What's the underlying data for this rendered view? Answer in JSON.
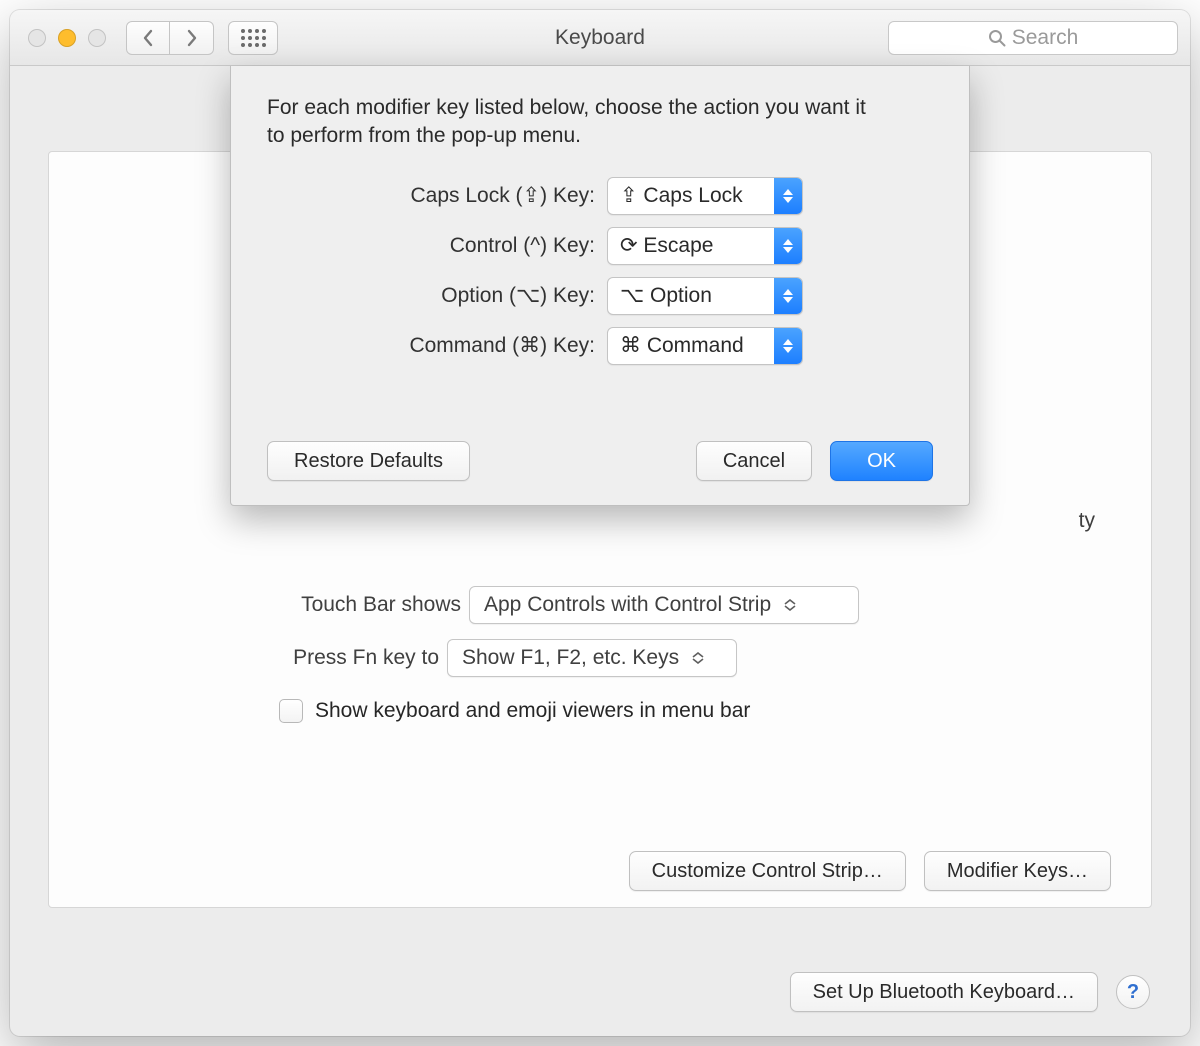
{
  "window": {
    "title": "Keyboard",
    "search_placeholder": "Search"
  },
  "sheet": {
    "description": "For each modifier key listed below, choose the action you want it to perform from the pop-up menu.",
    "rows": [
      {
        "label": "Caps Lock (⇪) Key:",
        "value": "⇪ Caps Lock"
      },
      {
        "label": "Control (^) Key:",
        "value": "⟳ Escape"
      },
      {
        "label": "Option (⌥) Key:",
        "value": "⌥ Option"
      },
      {
        "label": "Command (⌘) Key:",
        "value": "⌘ Command"
      }
    ],
    "restore": "Restore Defaults",
    "cancel": "Cancel",
    "ok": "OK"
  },
  "background": {
    "touch_bar_partial_label": "Touch Bar shows",
    "touch_bar_partial_value": "App Controls with Control Strip",
    "fn_label": "Press Fn key to",
    "fn_value": "Show F1, F2, etc. Keys",
    "checkbox_label": "Show keyboard and emoji viewers in menu bar",
    "customize": "Customize Control Strip…",
    "modifier": "Modifier Keys…",
    "right_edge_fragment": "ty"
  },
  "footer": {
    "bluetooth": "Set Up Bluetooth Keyboard…",
    "help": "?"
  }
}
